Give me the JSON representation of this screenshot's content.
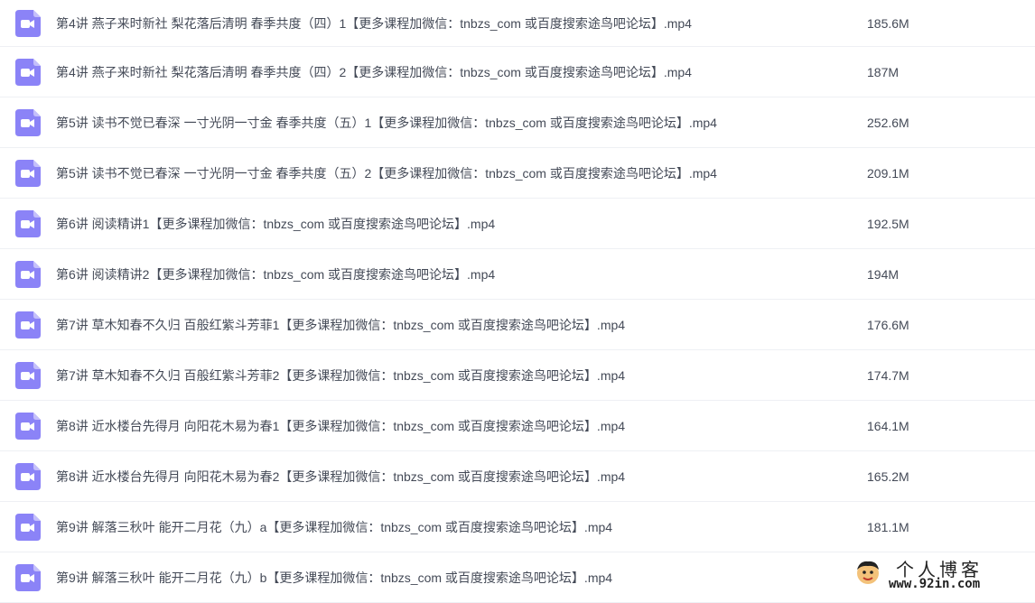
{
  "icon": "video-file-icon",
  "colors": {
    "icon_bg": "#8b83f7",
    "icon_fold": "#c4bffb",
    "text": "#444a57",
    "divider": "#eef0f4"
  },
  "files": [
    {
      "name": "第4讲 燕子来时新社 梨花落后清明 春季共度（四）1【更多课程加微信：tnbzs_com 或百度搜索途鸟吧论坛】.mp4",
      "size": "185.6M"
    },
    {
      "name": "第4讲 燕子来时新社 梨花落后清明 春季共度（四）2【更多课程加微信：tnbzs_com 或百度搜索途鸟吧论坛】.mp4",
      "size": "187M"
    },
    {
      "name": "第5讲 读书不觉已春深 一寸光阴一寸金 春季共度（五）1【更多课程加微信：tnbzs_com 或百度搜索途鸟吧论坛】.mp4",
      "size": "252.6M"
    },
    {
      "name": "第5讲 读书不觉已春深 一寸光阴一寸金 春季共度（五）2【更多课程加微信：tnbzs_com 或百度搜索途鸟吧论坛】.mp4",
      "size": "209.1M"
    },
    {
      "name": "第6讲 阅读精讲1【更多课程加微信：tnbzs_com 或百度搜索途鸟吧论坛】.mp4",
      "size": "192.5M"
    },
    {
      "name": "第6讲 阅读精讲2【更多课程加微信：tnbzs_com 或百度搜索途鸟吧论坛】.mp4",
      "size": "194M"
    },
    {
      "name": "第7讲 草木知春不久归 百般红紫斗芳菲1【更多课程加微信：tnbzs_com 或百度搜索途鸟吧论坛】.mp4",
      "size": "176.6M"
    },
    {
      "name": "第7讲 草木知春不久归 百般红紫斗芳菲2【更多课程加微信：tnbzs_com 或百度搜索途鸟吧论坛】.mp4",
      "size": "174.7M"
    },
    {
      "name": "第8讲 近水楼台先得月 向阳花木易为春1【更多课程加微信：tnbzs_com 或百度搜索途鸟吧论坛】.mp4",
      "size": "164.1M"
    },
    {
      "name": "第8讲 近水楼台先得月 向阳花木易为春2【更多课程加微信：tnbzs_com 或百度搜索途鸟吧论坛】.mp4",
      "size": "165.2M"
    },
    {
      "name": "第9讲 解落三秋叶 能开二月花（九）a【更多课程加微信：tnbzs_com 或百度搜索途鸟吧论坛】.mp4",
      "size": "181.1M"
    },
    {
      "name": "第9讲 解落三秋叶 能开二月花（九）b【更多课程加微信：tnbzs_com 或百度搜索途鸟吧论坛】.mp4",
      "size": ""
    }
  ],
  "watermark": {
    "title": "个人博客",
    "url": "www.92in.com"
  }
}
